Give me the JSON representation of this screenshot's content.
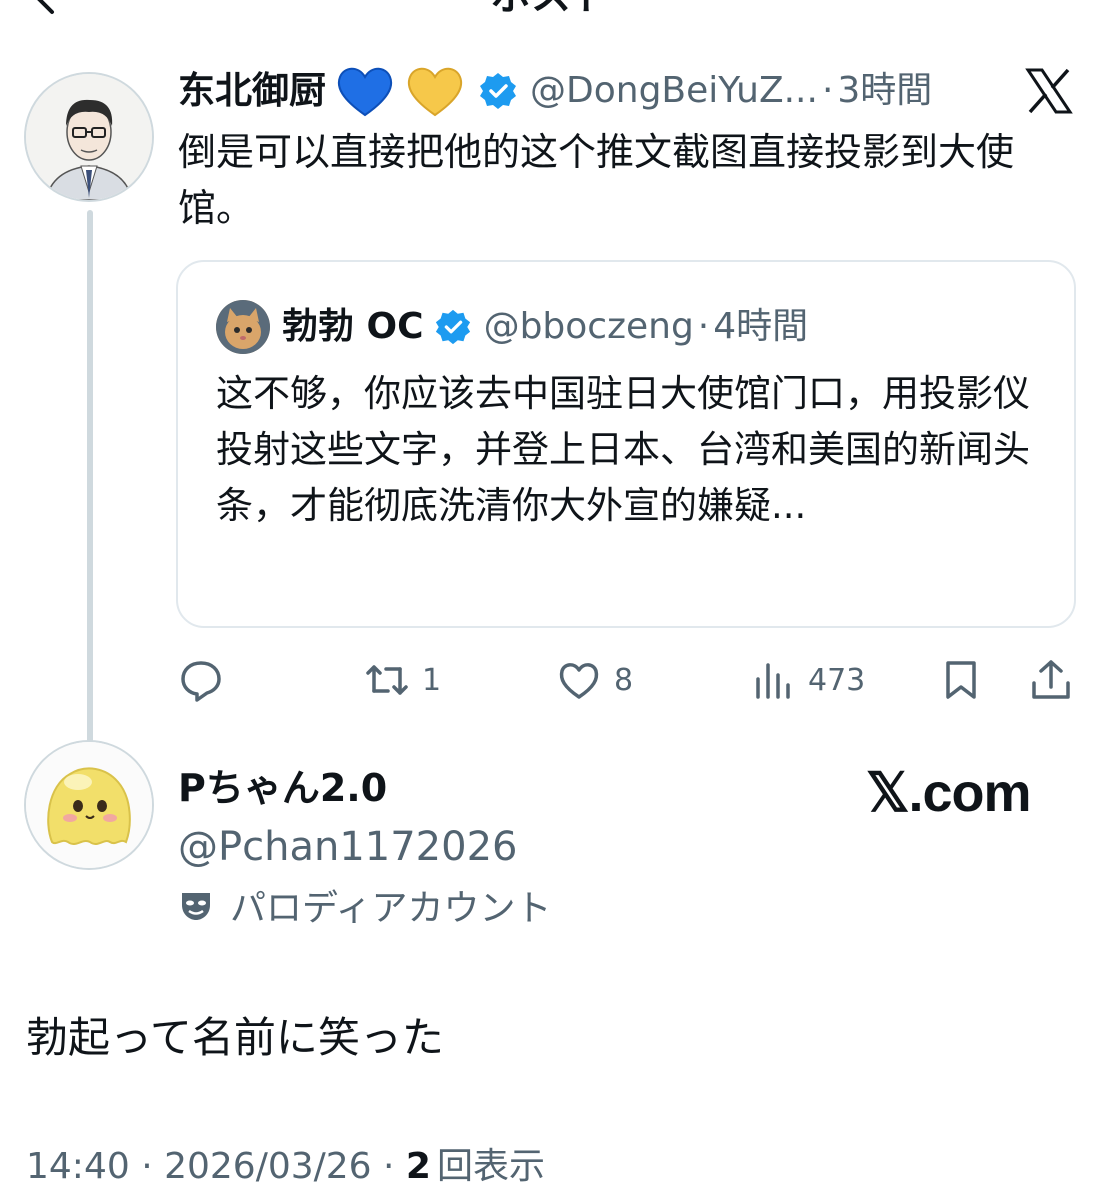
{
  "header": {
    "title": "ポスト"
  },
  "post1": {
    "author_name": "东北御厨",
    "name_emojis": "💙 💛",
    "handle": "@DongBeiYuZ...",
    "separator": "·",
    "time": "3時間",
    "text": "倒是可以直接把他的这个推文截图直接投影到大使馆。",
    "quote": {
      "author_name": "勃勃 OC",
      "handle": "@bboczeng",
      "separator": "·",
      "time": "4時間",
      "text": "这不够，你应该去中国驻日大使馆门口，用投影仪投射这些文字，并登上日本、台湾和美国的新闻头条，才能彻底洗清你大外宣的嫌疑..."
    },
    "actions": {
      "reply_count": "",
      "repost_count": "1",
      "like_count": "8",
      "views_count": "473"
    }
  },
  "post2": {
    "author_name": "Pちゃん2.0",
    "handle": "@Pchan1172026",
    "account_label": "パロディアカウント",
    "watermark": "𝕏.com",
    "text": "勃起って名前に笑った",
    "timestamp": "14:40 · 2026/03/26 · ",
    "views_count": "2",
    "views_label": "回表示"
  },
  "colors": {
    "text": "#0f1419",
    "muted": "#536471",
    "verified": "#1d9bf0",
    "border": "#e1e8ed"
  }
}
